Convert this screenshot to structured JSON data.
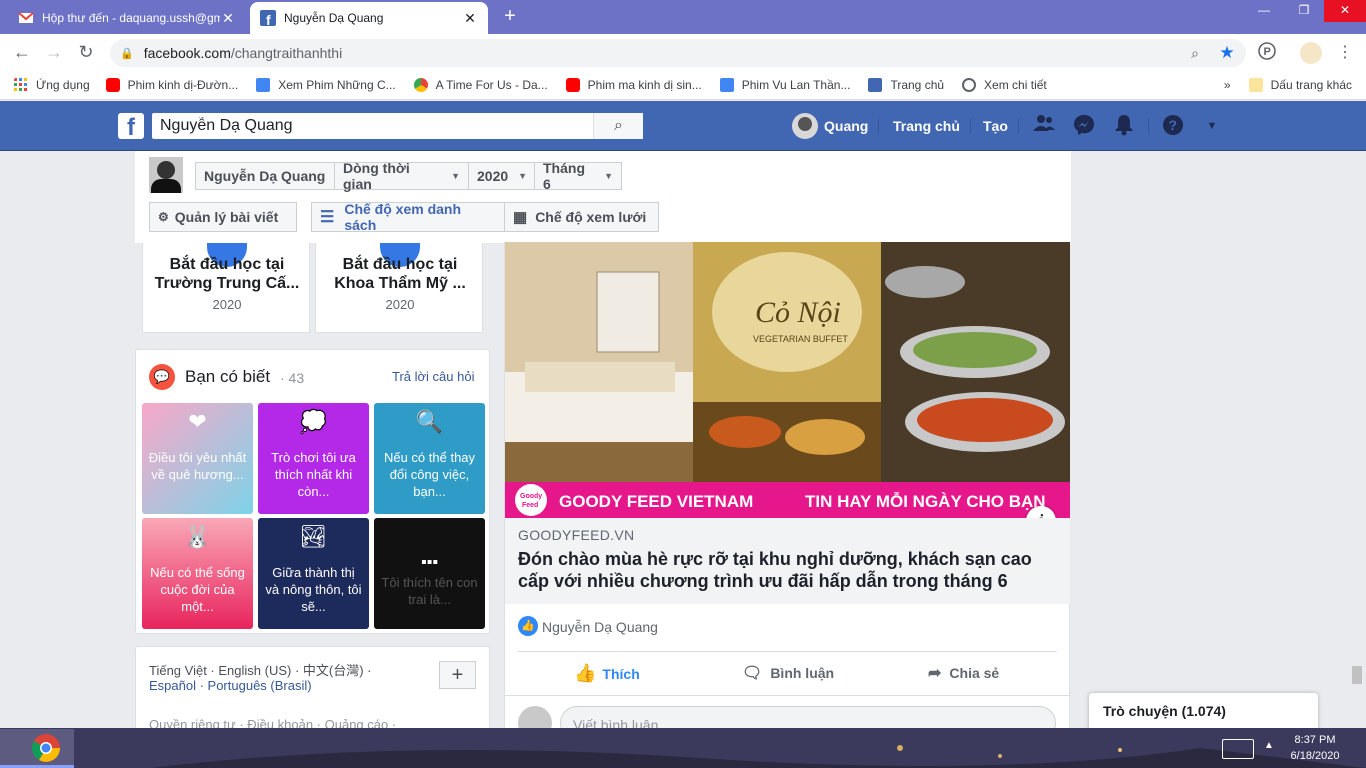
{
  "browser": {
    "tabs": [
      {
        "title": "Hộp thư đến - daquang.ussh@gmail.com",
        "favicon": "gmail-icon",
        "active": false
      },
      {
        "title": "Nguyễn Dạ Quang",
        "favicon": "facebook-icon",
        "active": true
      }
    ],
    "new_tab": "+",
    "window_controls": {
      "minimize": "—",
      "maximize": "❐",
      "close": "✕"
    },
    "url_domain": "facebook.com",
    "url_path": "/changtraithanhthi",
    "bookmarks": [
      {
        "label": "Ứng dụng",
        "icon": "apps-grid-icon",
        "color": "#ea4335"
      },
      {
        "label": "Phim kinh dị-Đườn...",
        "icon": "youtube-icon",
        "color": "#ff0000"
      },
      {
        "label": "Xem Phim Những C...",
        "icon": "film-icon",
        "color": "#4285f4"
      },
      {
        "label": "A Time For Us - Da...",
        "icon": "chrome-icon",
        "color": "#34a853"
      },
      {
        "label": "Phim ma kinh dị sin...",
        "icon": "youtube-icon",
        "color": "#ff0000"
      },
      {
        "label": "Phim Vu Lan Thần...",
        "icon": "film-icon",
        "color": "#4285f4"
      },
      {
        "label": "Trang chủ",
        "icon": "facebook-icon",
        "color": "#4267b2"
      },
      {
        "label": "Xem chi tiết",
        "icon": "globe-icon",
        "color": "#5f6368"
      }
    ],
    "bookmarks_more": "»",
    "other_bookmarks": "Dấu trang khác"
  },
  "fb_header": {
    "logo": "f",
    "search_value": "Nguyễn Dạ Quang",
    "profile_name": "Quang",
    "home": "Trang chủ",
    "create": "Tạo"
  },
  "timeline_controls": {
    "name": "Nguyễn Dạ Quang",
    "view": "Dòng thời gian",
    "year": "2020",
    "month": "Tháng 6",
    "manage_posts": "Quản lý bài viết",
    "list_view": "Chế độ xem danh sách",
    "grid_view": "Chế độ xem lưới"
  },
  "life_events": [
    {
      "title": "Bắt đầu học tại Trường Trung Cấ...",
      "year": "2020"
    },
    {
      "title": "Bắt đầu học tại Khoa Thẩm Mỹ ...",
      "year": "2020"
    }
  ],
  "did_you_know": {
    "title": "Bạn có biết",
    "count": "· 43",
    "answer_link": "Trả lời câu hỏi",
    "tiles": [
      {
        "text": "Điều tôi yêu nhất về quê hương...",
        "emoji": "❤",
        "bg": "linear-gradient(135deg,#f9a8c8,#7dd3e8)"
      },
      {
        "text": "Trò chơi tôi ưa thích nhất khi còn...",
        "emoji": "💭",
        "bg": "#b429e8"
      },
      {
        "text": "Nếu có thể thay đổi công việc, bạn...",
        "emoji": "🔍",
        "bg": "#2e9cc7"
      },
      {
        "text": "Nếu có thể sống cuộc đời của một...",
        "emoji": "🐰",
        "bg": "linear-gradient(180deg,#f9a8b8,#e8245c)"
      },
      {
        "text": "Giữa thành thị và nông thôn, tôi sẽ...",
        "emoji": "🏞",
        "bg": "#1d2a5c"
      },
      {
        "text": "Tôi thích tên con trai là...",
        "emoji": "▪▪▪",
        "bg": "#111111"
      }
    ]
  },
  "footer": {
    "languages_line1": "Tiếng Việt · English (US) · 中文(台灣) ·",
    "languages_line2": "Español · Português (Brasil)",
    "add": "+",
    "links": "Quyền riêng tư · Điều khoản · Quảng cáo ·"
  },
  "post": {
    "ad_brand": "GOODY FEED VIETNAM",
    "ad_tagline": "TIN HAY MỖI NGÀY CHO BẠN",
    "ad_logo_line1": "Goody",
    "ad_logo_line2": "Feed",
    "restaurant_name": "Cỏ Nội",
    "restaurant_sub": "VEGETARIAN BUFFET",
    "info": "i",
    "source": "GOODYFEED.VN",
    "headline": "Đón chào mùa hè rực rỡ tại khu nghỉ dưỡng, khách sạn cao cấp với nhiều chương trình ưu đãi hấp dẫn trong tháng 6",
    "liker": "Nguyễn Dạ Quang",
    "like": "Thích",
    "comment": "Bình luận",
    "share": "Chia sẻ",
    "comment_placeholder": "Viết bình luận..."
  },
  "chat": {
    "label": "Trò chuyện (1.074)"
  },
  "taskbar": {
    "time": "8:37 PM",
    "date": "6/18/2020"
  }
}
